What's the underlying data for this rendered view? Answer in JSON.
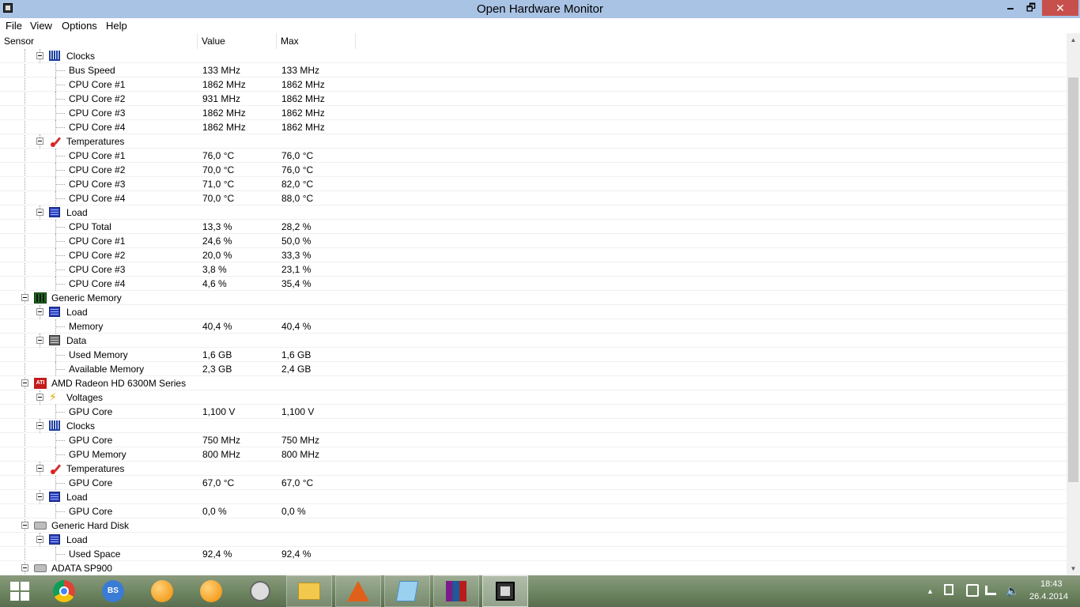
{
  "window": {
    "title": "Open Hardware Monitor",
    "minimize": "🗕",
    "maximize": "🗗",
    "close": "✕"
  },
  "menu": [
    "File",
    "View",
    "Options",
    "Help"
  ],
  "columns": {
    "sensor": "Sensor",
    "value": "Value",
    "max": "Max"
  },
  "rows": [
    {
      "kind": "group",
      "depth": 2,
      "icon": "clock-icon",
      "name": "Clocks",
      "value": "",
      "max": ""
    },
    {
      "kind": "sensor",
      "depth": 3,
      "name": "Bus Speed",
      "value": "133 MHz",
      "max": "133 MHz"
    },
    {
      "kind": "sensor",
      "depth": 3,
      "name": "CPU Core #1",
      "value": "1862 MHz",
      "max": "1862 MHz"
    },
    {
      "kind": "sensor",
      "depth": 3,
      "name": "CPU Core #2",
      "value": "931 MHz",
      "max": "1862 MHz"
    },
    {
      "kind": "sensor",
      "depth": 3,
      "name": "CPU Core #3",
      "value": "1862 MHz",
      "max": "1862 MHz"
    },
    {
      "kind": "sensor",
      "depth": 3,
      "name": "CPU Core #4",
      "value": "1862 MHz",
      "max": "1862 MHz"
    },
    {
      "kind": "group",
      "depth": 2,
      "icon": "thermometer-icon",
      "name": "Temperatures",
      "value": "",
      "max": ""
    },
    {
      "kind": "sensor",
      "depth": 3,
      "name": "CPU Core #1",
      "value": "76,0 °C",
      "max": "76,0 °C"
    },
    {
      "kind": "sensor",
      "depth": 3,
      "name": "CPU Core #2",
      "value": "70,0 °C",
      "max": "76,0 °C"
    },
    {
      "kind": "sensor",
      "depth": 3,
      "name": "CPU Core #3",
      "value": "71,0 °C",
      "max": "82,0 °C"
    },
    {
      "kind": "sensor",
      "depth": 3,
      "name": "CPU Core #4",
      "value": "70,0 °C",
      "max": "88,0 °C"
    },
    {
      "kind": "group",
      "depth": 2,
      "icon": "load-icon",
      "name": "Load",
      "value": "",
      "max": ""
    },
    {
      "kind": "sensor",
      "depth": 3,
      "name": "CPU Total",
      "value": "13,3 %",
      "max": "28,2 %"
    },
    {
      "kind": "sensor",
      "depth": 3,
      "name": "CPU Core #1",
      "value": "24,6 %",
      "max": "50,0 %"
    },
    {
      "kind": "sensor",
      "depth": 3,
      "name": "CPU Core #2",
      "value": "20,0 %",
      "max": "33,3 %"
    },
    {
      "kind": "sensor",
      "depth": 3,
      "name": "CPU Core #3",
      "value": "3,8 %",
      "max": "23,1 %"
    },
    {
      "kind": "sensor",
      "depth": 3,
      "name": "CPU Core #4",
      "value": "4,6 %",
      "max": "35,4 %"
    },
    {
      "kind": "hardware",
      "depth": 1,
      "icon": "memory-icon",
      "name": "Generic Memory",
      "value": "",
      "max": ""
    },
    {
      "kind": "group",
      "depth": 2,
      "icon": "load-icon",
      "name": "Load",
      "value": "",
      "max": ""
    },
    {
      "kind": "sensor",
      "depth": 3,
      "name": "Memory",
      "value": "40,4 %",
      "max": "40,4 %"
    },
    {
      "kind": "group",
      "depth": 2,
      "icon": "data-icon",
      "name": "Data",
      "value": "",
      "max": ""
    },
    {
      "kind": "sensor",
      "depth": 3,
      "name": "Used Memory",
      "value": "1,6 GB",
      "max": "1,6 GB"
    },
    {
      "kind": "sensor",
      "depth": 3,
      "name": "Available Memory",
      "value": "2,3 GB",
      "max": "2,4 GB"
    },
    {
      "kind": "hardware",
      "depth": 1,
      "icon": "gpu-icon",
      "name": "AMD Radeon HD 6300M Series",
      "value": "",
      "max": ""
    },
    {
      "kind": "group",
      "depth": 2,
      "icon": "voltage-icon",
      "name": "Voltages",
      "value": "",
      "max": ""
    },
    {
      "kind": "sensor",
      "depth": 3,
      "name": "GPU Core",
      "value": "1,100 V",
      "max": "1,100 V"
    },
    {
      "kind": "group",
      "depth": 2,
      "icon": "clock-icon",
      "name": "Clocks",
      "value": "",
      "max": ""
    },
    {
      "kind": "sensor",
      "depth": 3,
      "name": "GPU Core",
      "value": "750 MHz",
      "max": "750 MHz"
    },
    {
      "kind": "sensor",
      "depth": 3,
      "name": "GPU Memory",
      "value": "800 MHz",
      "max": "800 MHz"
    },
    {
      "kind": "group",
      "depth": 2,
      "icon": "thermometer-icon",
      "name": "Temperatures",
      "value": "",
      "max": ""
    },
    {
      "kind": "sensor",
      "depth": 3,
      "name": "GPU Core",
      "value": "67,0 °C",
      "max": "67,0 °C"
    },
    {
      "kind": "group",
      "depth": 2,
      "icon": "load-icon",
      "name": "Load",
      "value": "",
      "max": ""
    },
    {
      "kind": "sensor",
      "depth": 3,
      "name": "GPU Core",
      "value": "0,0 %",
      "max": "0,0 %"
    },
    {
      "kind": "hardware",
      "depth": 1,
      "icon": "hard-disk-icon",
      "name": "Generic Hard Disk",
      "value": "",
      "max": ""
    },
    {
      "kind": "group",
      "depth": 2,
      "icon": "load-icon",
      "name": "Load",
      "value": "",
      "max": ""
    },
    {
      "kind": "sensor",
      "depth": 3,
      "name": "Used Space",
      "value": "92,4 %",
      "max": "92,4 %"
    },
    {
      "kind": "hardware",
      "depth": 1,
      "icon": "hard-disk-icon",
      "name": "ADATA SP900",
      "value": "",
      "max": ""
    }
  ],
  "scrollbar": {
    "up": "▲",
    "down": "▼"
  },
  "taskbar": {
    "apps": [
      {
        "name": "start-button",
        "icon": "windows-logo-icon"
      },
      {
        "name": "chrome",
        "icon": "chrome-icon"
      },
      {
        "name": "bluestacks",
        "icon": "bluestacks-icon",
        "label": "BS"
      },
      {
        "name": "app-orange-1",
        "icon": "orange-app-icon"
      },
      {
        "name": "app-orange-2",
        "icon": "orange-app-icon"
      },
      {
        "name": "speedometer",
        "icon": "gauge-icon"
      },
      {
        "name": "file-explorer",
        "icon": "folder-icon"
      },
      {
        "name": "matlab",
        "icon": "matlab-icon"
      },
      {
        "name": "notebook",
        "icon": "book-icon"
      },
      {
        "name": "winrar",
        "icon": "winrar-icon"
      },
      {
        "name": "open-hardware-monitor",
        "icon": "ohm-icon"
      }
    ],
    "tray": {
      "chevron": "▲",
      "time": "18:43",
      "date": "26.4.2014"
    }
  }
}
